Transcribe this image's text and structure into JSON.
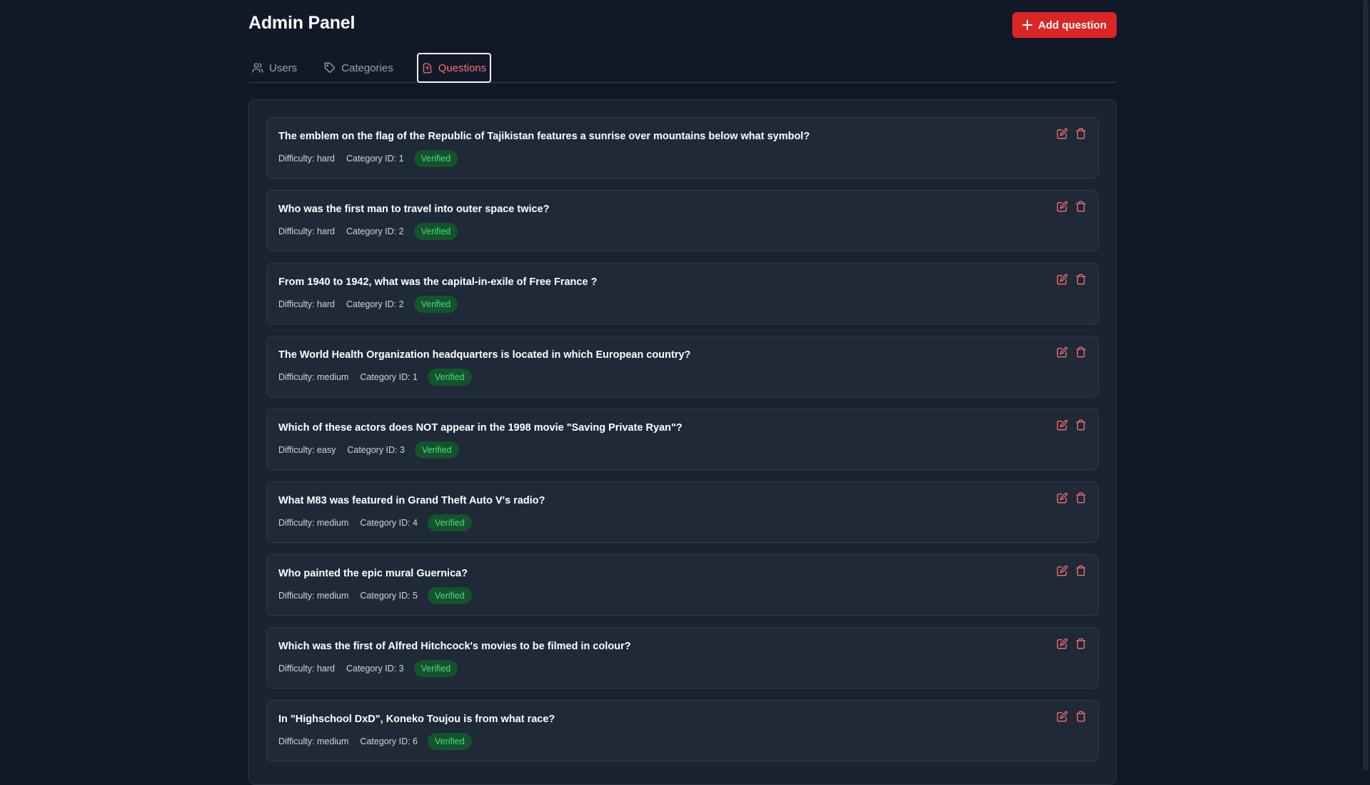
{
  "header": {
    "title": "Admin Panel",
    "add_button_label": "Add question"
  },
  "tabs": [
    {
      "label": "Users",
      "icon": "users-icon",
      "active": false
    },
    {
      "label": "Categories",
      "icon": "tag-icon",
      "active": false
    },
    {
      "label": "Questions",
      "icon": "file-question-icon",
      "active": true
    }
  ],
  "labels": {
    "difficulty_prefix": "Difficulty:",
    "category_prefix": "Category ID:"
  },
  "questions": [
    {
      "text": "The emblem on the flag of the Republic of Tajikistan features a sunrise over mountains below what symbol?",
      "difficulty": "Difficulty: hard",
      "category": "Category ID: 1",
      "status": "Verified"
    },
    {
      "text": "Who was the first man to travel into outer space twice?",
      "difficulty": "Difficulty: hard",
      "category": "Category ID: 2",
      "status": "Verified"
    },
    {
      "text": "From 1940 to 1942, what was the capital-in-exile of Free France ?",
      "difficulty": "Difficulty: hard",
      "category": "Category ID: 2",
      "status": "Verified"
    },
    {
      "text": "The World Health Organization headquarters is located in which European country?",
      "difficulty": "Difficulty: medium",
      "category": "Category ID: 1",
      "status": "Verified"
    },
    {
      "text": "Which of these actors does NOT appear in the 1998 movie \"Saving Private Ryan\"?",
      "difficulty": "Difficulty: easy",
      "category": "Category ID: 3",
      "status": "Verified"
    },
    {
      "text": "What M83 was featured in Grand Theft Auto V's radio?",
      "difficulty": "Difficulty: medium",
      "category": "Category ID: 4",
      "status": "Verified"
    },
    {
      "text": "Who painted the epic mural Guernica?",
      "difficulty": "Difficulty: medium",
      "category": "Category ID: 5",
      "status": "Verified"
    },
    {
      "text": "Which was the first of Alfred Hitchcock's movies to be filmed in colour?",
      "difficulty": "Difficulty: hard",
      "category": "Category ID: 3",
      "status": "Verified"
    },
    {
      "text": "In \"Highschool DxD\", Koneko Toujou is from what race?",
      "difficulty": "Difficulty: medium",
      "category": "Category ID: 6",
      "status": "Verified"
    }
  ],
  "colors": {
    "background": "#111827",
    "accent": "#dc2626",
    "accent_text": "#f87171",
    "badge_bg": "#14532d",
    "badge_text": "#4ade80"
  }
}
